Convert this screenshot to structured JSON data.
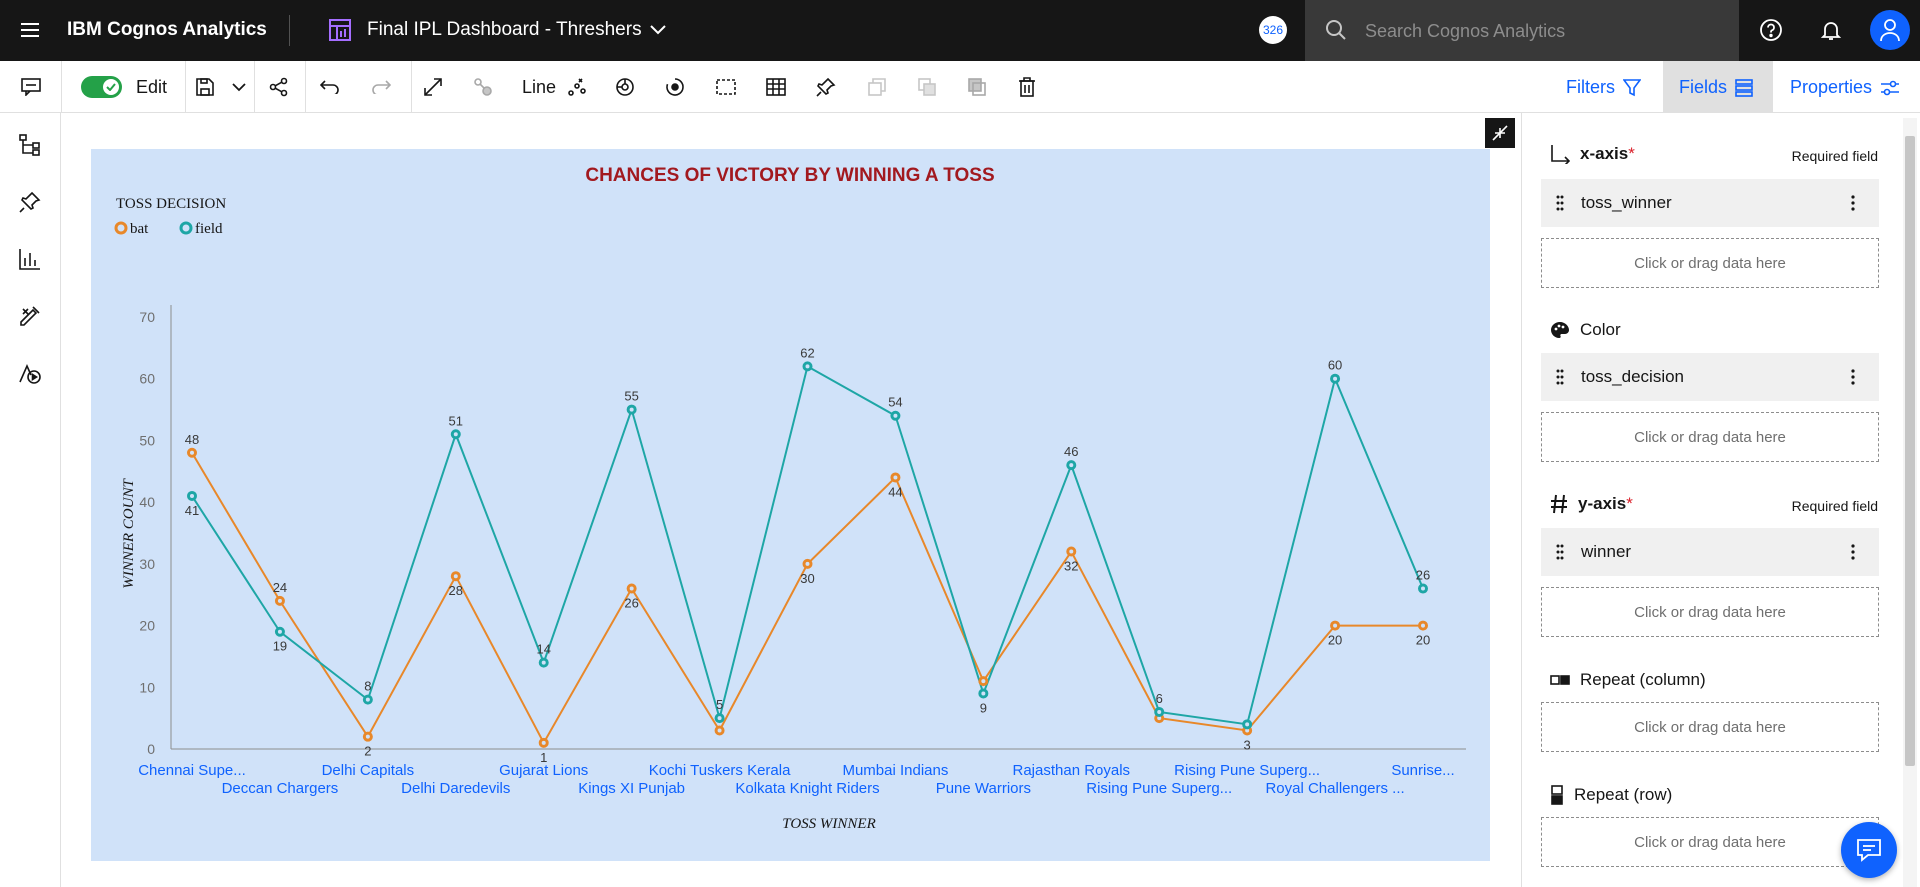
{
  "topbar": {
    "brand": "IBM Cognos Analytics",
    "dashboard_title": "Final IPL Dashboard - Threshers",
    "count_badge": "326",
    "search_placeholder": "Search Cognos Analytics"
  },
  "toolbar": {
    "edit_label": "Edit",
    "edit_toggle_on": true,
    "visualization_type": "Line",
    "filters_label": "Filters",
    "fields_label": "Fields",
    "properties_label": "Properties"
  },
  "fields_panel": {
    "x_axis": {
      "title": "x-axis",
      "required_label": "Required field",
      "field": "toss_winner",
      "drop_hint": "Click or drag data here"
    },
    "color": {
      "title": "Color",
      "field": "toss_decision",
      "drop_hint": "Click or drag data here"
    },
    "y_axis": {
      "title": "y-axis",
      "required_label": "Required field",
      "field": "winner",
      "drop_hint": "Click or drag data here"
    },
    "repeat_column": {
      "title": "Repeat (column)",
      "drop_hint": "Click or drag data here"
    },
    "repeat_row": {
      "title": "Repeat (row)",
      "drop_hint": "Click or drag data here"
    }
  },
  "chart_data": {
    "type": "line",
    "title": "CHANCES OF VICTORY BY WINNING A TOSS",
    "legend_title": "TOSS DECISION",
    "legend_position": "top-left",
    "xlabel": "TOSS WINNER",
    "ylabel": "WINNER COUNT",
    "ylim": [
      0,
      70
    ],
    "yticks": [
      0,
      10,
      20,
      30,
      40,
      50,
      60,
      70
    ],
    "grid": false,
    "categories": [
      "Chennai Supe...",
      "Deccan Chargers",
      "Delhi Capitals",
      "Delhi Daredevils",
      "Gujarat Lions",
      "Kings XI Punjab",
      "Kochi Tuskers Kerala",
      "Kolkata Knight Riders",
      "Mumbai Indians",
      "Pune Warriors",
      "Rajasthan Royals",
      "Rising Pune Superg...",
      "Rising Pune Superg...",
      "Royal Challengers ...",
      "Sunrise..."
    ],
    "series": [
      {
        "name": "bat",
        "color": "#e8882a",
        "values": [
          48,
          24,
          2,
          28,
          1,
          26,
          3,
          30,
          44,
          11,
          32,
          5,
          3,
          20,
          20
        ],
        "labels": [
          "48",
          "24",
          "2",
          "28",
          "1",
          "26",
          "",
          "30",
          "44",
          "",
          "32",
          "",
          "3",
          "20",
          "20"
        ]
      },
      {
        "name": "field",
        "color": "#1ea6a6",
        "values": [
          41,
          19,
          8,
          51,
          14,
          55,
          5,
          62,
          54,
          9,
          46,
          6,
          4,
          60,
          26
        ],
        "labels": [
          "41",
          "19",
          "8",
          "51",
          "14",
          "55",
          "5",
          "62",
          "54",
          "9",
          "46",
          "6",
          "",
          "60",
          "26"
        ]
      }
    ]
  },
  "colors": {
    "topbar_bg": "#161616",
    "accent": "#0f62fe",
    "chart_bg": "#d0e2f9",
    "chart_title": "#a2191f",
    "toggle_on": "#24a148"
  },
  "icons": {
    "left_rail": [
      "hierarchy-icon",
      "pin-icon",
      "bar-chart-icon",
      "tools-icon",
      "data-play-icon"
    ]
  }
}
